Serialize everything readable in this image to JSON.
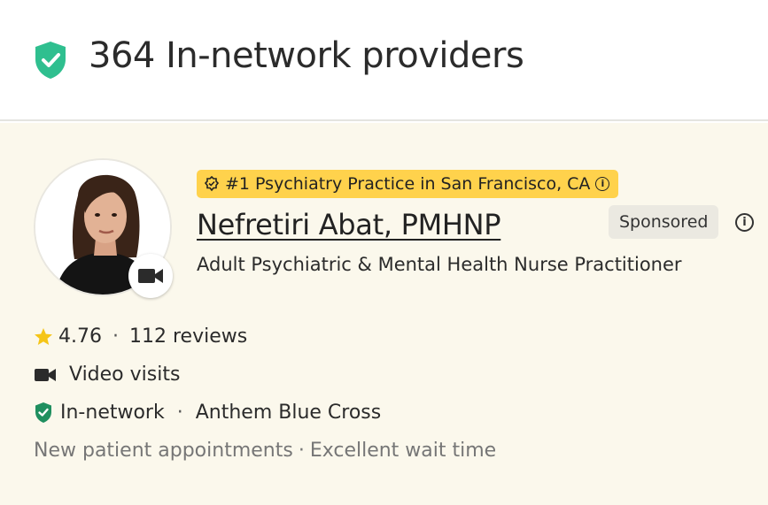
{
  "header": {
    "title": "364 In-network providers",
    "icon": "shield-check-icon",
    "icon_color": "#2fbf8f"
  },
  "provider": {
    "award": "#1 Psychiatry Practice in San Francisco, CA",
    "award_color": "#ffd24c",
    "name": "Nefretiri Abat, PMHNP",
    "sponsored_label": "Sponsored",
    "specialty": "Adult Psychiatric & Mental Health Nurse Practitioner",
    "rating": "4.76",
    "reviews": "112 reviews",
    "visit_type": "Video visits",
    "network_status": "In-network",
    "insurance": "Anthem Blue Cross",
    "appointments": "New patient appointments",
    "wait_time": "Excellent wait time",
    "star_color": "#f5c518",
    "network_icon_color": "#1f8f5f"
  },
  "card_background": "#fbf8ec"
}
